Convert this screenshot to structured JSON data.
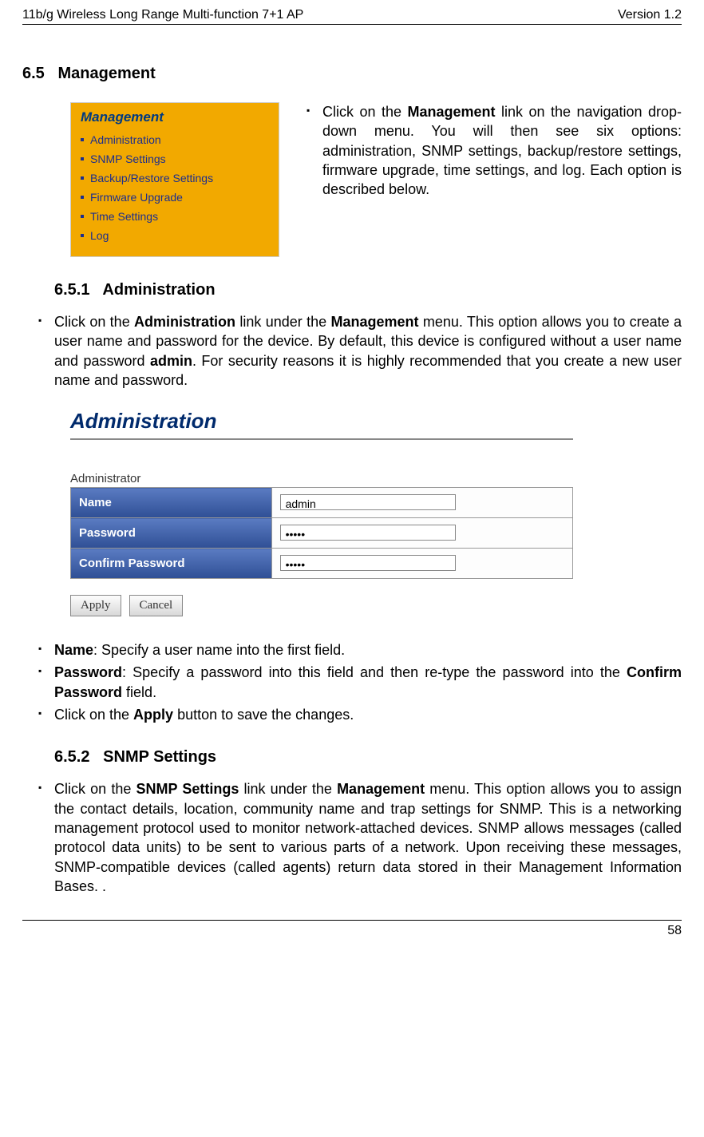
{
  "header": {
    "left": "11b/g Wireless Long Range Multi-function 7+1 AP",
    "right": "Version 1.2"
  },
  "section": {
    "num": "6.5",
    "title": "Management"
  },
  "nav": {
    "title": "Management",
    "items": [
      "Administration",
      "SNMP Settings",
      "Backup/Restore Settings",
      "Firmware Upgrade",
      "Time Settings",
      "Log"
    ]
  },
  "intro": {
    "pre": "Click on the ",
    "bold": "Management",
    "post": " link on the navigation drop-down menu. You will then see six options: administration, SNMP settings, backup/restore settings, firmware upgrade, time settings, and log. Each option is described below."
  },
  "sub1": {
    "num": "6.5.1",
    "title": "Administration",
    "para_pre": "Click on the ",
    "para_b1": "Administration",
    "para_mid1": " link under the ",
    "para_b2": "Management",
    "para_mid2": " menu. This option allows you to create a user name and password for the device. By default, this device is configured without a user name and password ",
    "para_b3": "admin",
    "para_post": ". For security reasons it is highly recommended that you create a new user name and password."
  },
  "admin_panel": {
    "title": "Administration",
    "group": "Administrator",
    "rows": [
      {
        "label": "Name",
        "value": "admin",
        "type": "text"
      },
      {
        "label": "Password",
        "value": "•••••",
        "type": "password"
      },
      {
        "label": "Confirm Password",
        "value": "•••••",
        "type": "password"
      }
    ],
    "buttons": {
      "apply": "Apply",
      "cancel": "Cancel"
    }
  },
  "fields": {
    "name": {
      "b": "Name",
      "t": ": Specify a user name into the first field."
    },
    "password": {
      "b": "Password",
      "t": ": Specify a password into this field and then re-type the password into the ",
      "b2": "Confirm Password",
      "t2": " field."
    },
    "apply": {
      "pre": "Click on the ",
      "b": "Apply",
      "post": " button to save the changes."
    }
  },
  "sub2": {
    "num": "6.5.2",
    "title": "SNMP Settings",
    "para_pre": "Click on the ",
    "para_b1": "SNMP Settings",
    "para_mid1": " link under the ",
    "para_b2": "Management",
    "para_post": " menu. This option allows you to assign the contact details, location, community name and trap settings for SNMP. This is a networking management protocol used to monitor network-attached devices. SNMP allows messages (called protocol data units) to be sent to various parts of a network. Upon receiving these messages, SNMP-compatible devices (called agents) return data stored in their Management Information Bases. ."
  },
  "page_num": "58"
}
